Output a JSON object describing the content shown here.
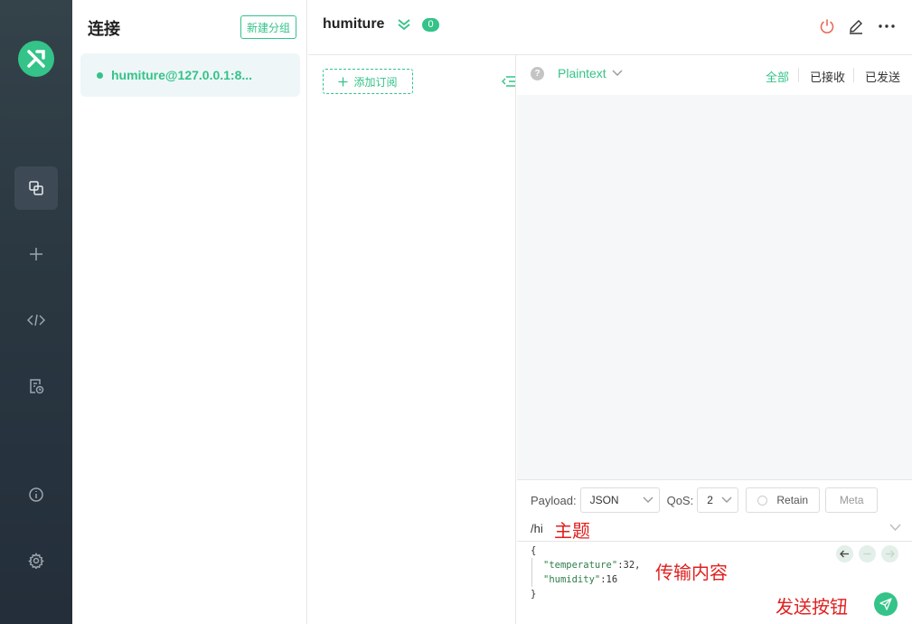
{
  "nav": {
    "items": [
      "connections",
      "new-connection",
      "scripts",
      "logs",
      "about",
      "settings"
    ]
  },
  "connections_panel": {
    "title": "连接",
    "new_group_label": "新建分组",
    "items": [
      {
        "name": "humiture@127.0.0.1:8...",
        "status": "connected"
      }
    ]
  },
  "header": {
    "title": "humiture",
    "message_count": "0"
  },
  "subscriptions": {
    "add_label": "添加订阅"
  },
  "messages": {
    "help": "?",
    "format": "Plaintext",
    "filters": [
      "全部",
      "已接收",
      "已发送"
    ],
    "active_filter": "全部"
  },
  "publish": {
    "payload_label": "Payload:",
    "payload_format": "JSON",
    "qos_label": "QoS:",
    "qos_value": "2",
    "retain_label": "Retain",
    "meta_label": "Meta",
    "topic": "/hi",
    "payload_lines": [
      "{",
      "\"temperature\"",
      ":32,",
      "\"humidity\"",
      ":16",
      "}"
    ]
  },
  "annotations": {
    "topic": "主题",
    "payload": "传输内容",
    "send": "发送按钮"
  },
  "colors": {
    "accent": "#34c388",
    "sidebar_dark": "#2a3741",
    "power_icon": "#e86a5a",
    "annotation": "#e02020"
  }
}
